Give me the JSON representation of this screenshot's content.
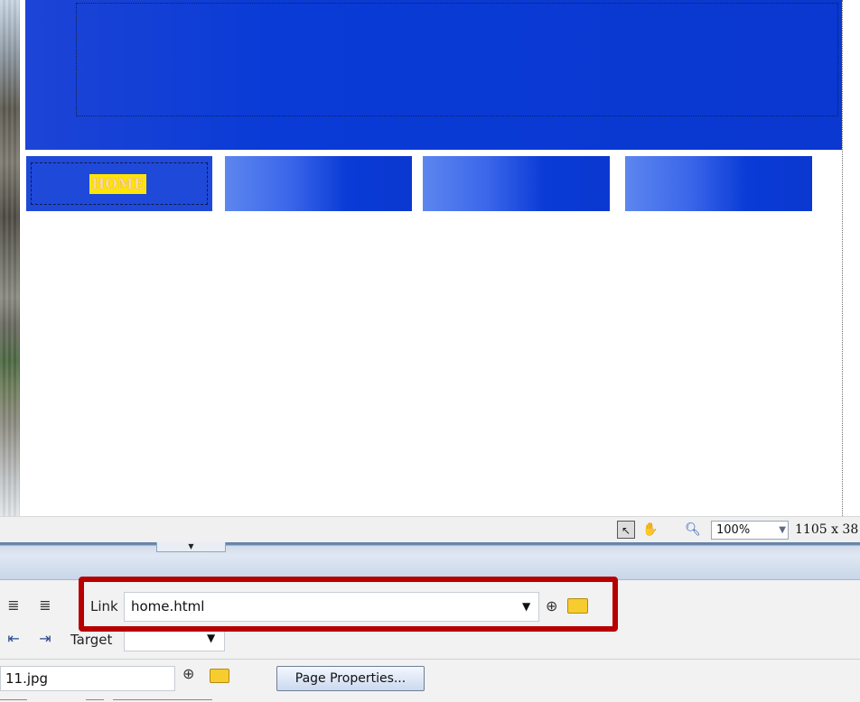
{
  "nav": {
    "home_label": "HOME"
  },
  "statusbar": {
    "zoom": "100%",
    "dimensions": "1105 x 38"
  },
  "properties": {
    "link_label": "Link",
    "link_value": "home.html",
    "target_label": "Target",
    "target_value": "",
    "src_value": "11.jpg",
    "page_properties_label": "Page Properties..."
  },
  "icons": {
    "select_tool": "arrow-pointer-icon",
    "hand_tool": "hand-icon",
    "zoom_tool": "magnifier-icon",
    "point_to_file": "point-to-file-icon",
    "browse_folder": "folder-icon"
  },
  "colors": {
    "banner_blue": "#0a3bd6",
    "highlight_red": "#b70000",
    "home_label_bg": "#ffe600"
  }
}
